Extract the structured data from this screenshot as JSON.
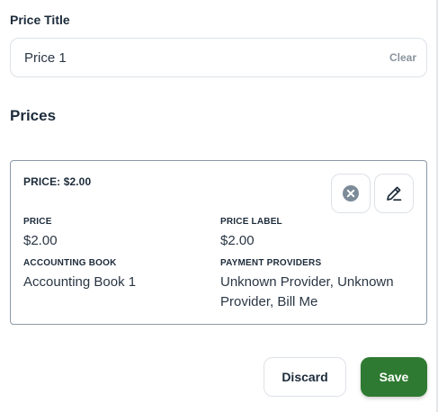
{
  "price_title": {
    "label": "Price Title",
    "value": "Price 1",
    "clear_label": "Clear"
  },
  "prices_section": {
    "title": "Prices"
  },
  "price_card": {
    "heading": "PRICE: $2.00",
    "price_label": "PRICE",
    "price_value": "$2.00",
    "price_label_label": "PRICE LABEL",
    "price_label_value": "$2.00",
    "accounting_book_label": "ACCOUNTING BOOK",
    "accounting_book_value": "Accounting Book 1",
    "payment_providers_label": "PAYMENT PROVIDERS",
    "payment_providers_value": "Unknown Provider, Unknown Provider, Bill Me",
    "remove_icon": "close-circle-icon",
    "edit_icon": "pencil-icon"
  },
  "actions": {
    "discard_label": "Discard",
    "save_label": "Save"
  },
  "colors": {
    "primary_green": "#2f7a32",
    "text_dark": "#1c2b3a",
    "muted": "#8a949e",
    "card_border": "#8b99a6"
  }
}
